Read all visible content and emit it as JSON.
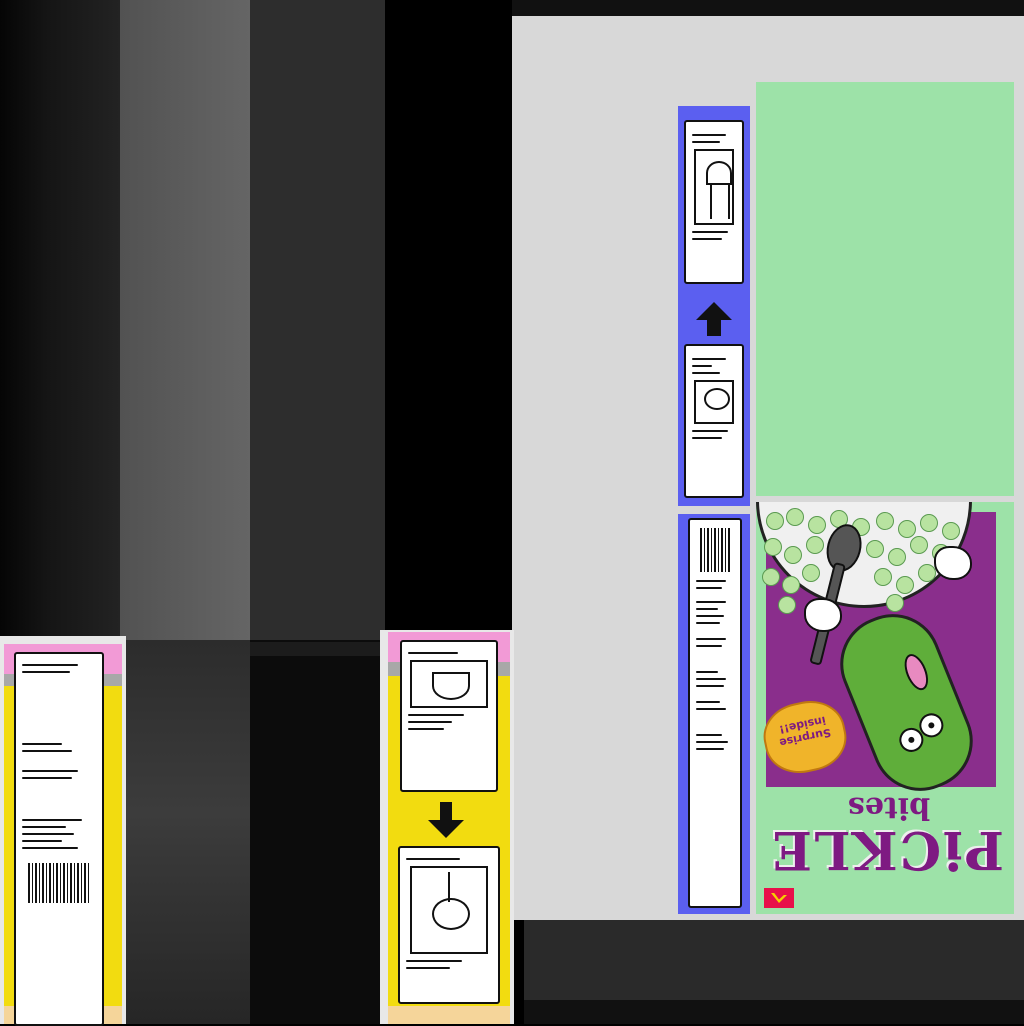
{
  "box": {
    "brand_title": "PiCKLE",
    "brand_subtitle": "bites",
    "badge_text": "Surprise inside!!"
  },
  "colors": {
    "blue_strip": "#5b5ff0",
    "mint": "#9de2a8",
    "purple": "#8a2e8c",
    "yellow": "#f2dc10",
    "pink": "#f29ad6"
  },
  "icons": [
    "arrow-up-icon",
    "arrow-down-icon",
    "barcode-icon",
    "spoon-icon",
    "pickle-mascot-icon"
  ]
}
